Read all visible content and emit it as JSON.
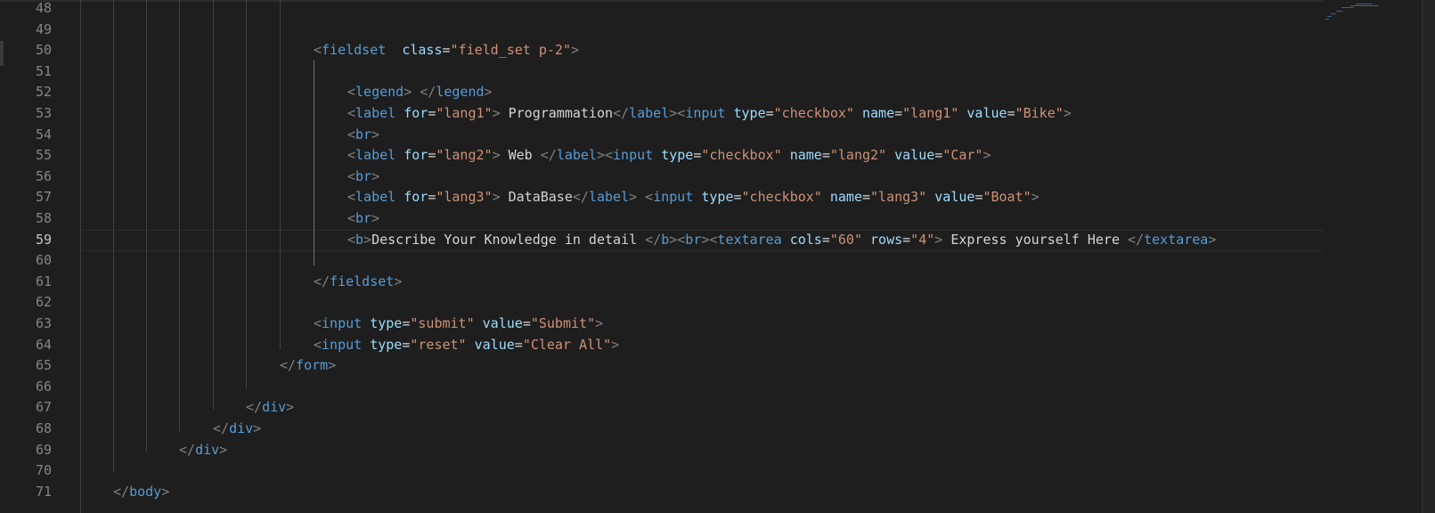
{
  "editor": {
    "line_numbers": [
      "48",
      "49",
      "50",
      "51",
      "52",
      "53",
      "54",
      "55",
      "56",
      "57",
      "58",
      "59",
      "60",
      "61",
      "62",
      "63",
      "64",
      "65",
      "66",
      "67",
      "68",
      "69",
      "70",
      "71"
    ],
    "active_line": "59",
    "lines": [
      {
        "n": "50",
        "tokens": [
          [
            "t",
            "<"
          ],
          [
            "tag",
            "fieldset"
          ],
          [
            "txt",
            "  "
          ],
          [
            "attr",
            "class"
          ],
          [
            "txt",
            "="
          ],
          [
            "str",
            "\"field_set p-2\""
          ],
          [
            "t",
            ">"
          ]
        ]
      },
      {
        "n": "52",
        "tokens": [
          [
            "t",
            "<"
          ],
          [
            "tag",
            "legend"
          ],
          [
            "t",
            ">"
          ],
          [
            "txt",
            " "
          ],
          [
            "t",
            "</"
          ],
          [
            "tag",
            "legend"
          ],
          [
            "t",
            ">"
          ]
        ]
      },
      {
        "n": "53",
        "tokens": [
          [
            "t",
            "<"
          ],
          [
            "tag",
            "label"
          ],
          [
            "txt",
            " "
          ],
          [
            "attr",
            "for"
          ],
          [
            "txt",
            "="
          ],
          [
            "str",
            "\"lang1\""
          ],
          [
            "t",
            ">"
          ],
          [
            "txt",
            " Programmation"
          ],
          [
            "t",
            "</"
          ],
          [
            "tag",
            "label"
          ],
          [
            "t",
            "><"
          ],
          [
            "tag",
            "input"
          ],
          [
            "txt",
            " "
          ],
          [
            "attr",
            "type"
          ],
          [
            "txt",
            "="
          ],
          [
            "str",
            "\"checkbox\""
          ],
          [
            "txt",
            " "
          ],
          [
            "attr",
            "name"
          ],
          [
            "txt",
            "="
          ],
          [
            "str",
            "\"lang1\""
          ],
          [
            "txt",
            " "
          ],
          [
            "attr",
            "value"
          ],
          [
            "txt",
            "="
          ],
          [
            "str",
            "\"Bike\""
          ],
          [
            "t",
            ">"
          ]
        ]
      },
      {
        "n": "54",
        "tokens": [
          [
            "t",
            "<"
          ],
          [
            "tag",
            "br"
          ],
          [
            "t",
            ">"
          ]
        ]
      },
      {
        "n": "55",
        "tokens": [
          [
            "t",
            "<"
          ],
          [
            "tag",
            "label"
          ],
          [
            "txt",
            " "
          ],
          [
            "attr",
            "for"
          ],
          [
            "txt",
            "="
          ],
          [
            "str",
            "\"lang2\""
          ],
          [
            "t",
            ">"
          ],
          [
            "txt",
            " Web "
          ],
          [
            "t",
            "</"
          ],
          [
            "tag",
            "label"
          ],
          [
            "t",
            "><"
          ],
          [
            "tag",
            "input"
          ],
          [
            "txt",
            " "
          ],
          [
            "attr",
            "type"
          ],
          [
            "txt",
            "="
          ],
          [
            "str",
            "\"checkbox\""
          ],
          [
            "txt",
            " "
          ],
          [
            "attr",
            "name"
          ],
          [
            "txt",
            "="
          ],
          [
            "str",
            "\"lang2\""
          ],
          [
            "txt",
            " "
          ],
          [
            "attr",
            "value"
          ],
          [
            "txt",
            "="
          ],
          [
            "str",
            "\"Car\""
          ],
          [
            "t",
            ">"
          ]
        ]
      },
      {
        "n": "56",
        "tokens": [
          [
            "t",
            "<"
          ],
          [
            "tag",
            "br"
          ],
          [
            "t",
            ">"
          ]
        ]
      },
      {
        "n": "57",
        "tokens": [
          [
            "t",
            "<"
          ],
          [
            "tag",
            "label"
          ],
          [
            "txt",
            " "
          ],
          [
            "attr",
            "for"
          ],
          [
            "txt",
            "="
          ],
          [
            "str",
            "\"lang3\""
          ],
          [
            "t",
            ">"
          ],
          [
            "txt",
            " DataBase"
          ],
          [
            "t",
            "</"
          ],
          [
            "tag",
            "label"
          ],
          [
            "t",
            ">"
          ],
          [
            "txt",
            " "
          ],
          [
            "t",
            "<"
          ],
          [
            "tag",
            "input"
          ],
          [
            "txt",
            " "
          ],
          [
            "attr",
            "type"
          ],
          [
            "txt",
            "="
          ],
          [
            "str",
            "\"checkbox\""
          ],
          [
            "txt",
            " "
          ],
          [
            "attr",
            "name"
          ],
          [
            "txt",
            "="
          ],
          [
            "str",
            "\"lang3\""
          ],
          [
            "txt",
            " "
          ],
          [
            "attr",
            "value"
          ],
          [
            "txt",
            "="
          ],
          [
            "str",
            "\"Boat\""
          ],
          [
            "t",
            ">"
          ]
        ]
      },
      {
        "n": "58",
        "tokens": [
          [
            "t",
            "<"
          ],
          [
            "tag",
            "br"
          ],
          [
            "t",
            ">"
          ]
        ]
      },
      {
        "n": "59",
        "tokens": [
          [
            "t",
            "<"
          ],
          [
            "tag",
            "b"
          ],
          [
            "t",
            ">"
          ],
          [
            "txt",
            "Describe Your Knowledge in detail "
          ],
          [
            "t",
            "</"
          ],
          [
            "tag",
            "b"
          ],
          [
            "t",
            "><"
          ],
          [
            "tag",
            "br"
          ],
          [
            "t",
            "><"
          ],
          [
            "tag",
            "textarea"
          ],
          [
            "txt",
            " "
          ],
          [
            "attr",
            "cols"
          ],
          [
            "txt",
            "="
          ],
          [
            "str",
            "\"60\""
          ],
          [
            "txt",
            " "
          ],
          [
            "attr",
            "rows"
          ],
          [
            "txt",
            "="
          ],
          [
            "str",
            "\"4\""
          ],
          [
            "t",
            ">"
          ],
          [
            "txt",
            " Express yourself Here "
          ],
          [
            "t",
            "</"
          ],
          [
            "tag",
            "textarea"
          ],
          [
            "t",
            ">"
          ]
        ]
      },
      {
        "n": "61",
        "tokens": [
          [
            "t",
            "</"
          ],
          [
            "tag",
            "fieldset"
          ],
          [
            "t",
            ">"
          ]
        ]
      },
      {
        "n": "63",
        "tokens": [
          [
            "t",
            "<"
          ],
          [
            "tag",
            "input"
          ],
          [
            "txt",
            " "
          ],
          [
            "attr",
            "type"
          ],
          [
            "txt",
            "="
          ],
          [
            "str",
            "\"submit\""
          ],
          [
            "txt",
            " "
          ],
          [
            "attr",
            "value"
          ],
          [
            "txt",
            "="
          ],
          [
            "str",
            "\"Submit\""
          ],
          [
            "t",
            ">"
          ]
        ]
      },
      {
        "n": "64",
        "tokens": [
          [
            "t",
            "<"
          ],
          [
            "tag",
            "input"
          ],
          [
            "txt",
            " "
          ],
          [
            "attr",
            "type"
          ],
          [
            "txt",
            "="
          ],
          [
            "str",
            "\"reset\""
          ],
          [
            "txt",
            " "
          ],
          [
            "attr",
            "value"
          ],
          [
            "txt",
            "="
          ],
          [
            "str",
            "\"Clear All\""
          ],
          [
            "t",
            ">"
          ]
        ]
      },
      {
        "n": "65",
        "tokens": [
          [
            "t",
            "</"
          ],
          [
            "tag",
            "form"
          ],
          [
            "t",
            ">"
          ]
        ]
      },
      {
        "n": "67",
        "tokens": [
          [
            "t",
            "</"
          ],
          [
            "tag",
            "div"
          ],
          [
            "t",
            ">"
          ]
        ]
      },
      {
        "n": "68",
        "tokens": [
          [
            "t",
            "</"
          ],
          [
            "tag",
            "div"
          ],
          [
            "t",
            ">"
          ]
        ]
      },
      {
        "n": "69",
        "tokens": [
          [
            "t",
            "</"
          ],
          [
            "tag",
            "div"
          ],
          [
            "t",
            ">"
          ]
        ]
      },
      {
        "n": "71",
        "tokens": [
          [
            "t",
            "</"
          ],
          [
            "tag",
            "body"
          ],
          [
            "t",
            ">"
          ]
        ]
      }
    ]
  },
  "colors": {
    "background": "#1e1e1e",
    "punctuation": "#808080",
    "tag": "#569cd6",
    "attribute": "#9cdcfe",
    "string": "#ce9178",
    "text": "#d4d4d4",
    "line_number": "#858585"
  }
}
